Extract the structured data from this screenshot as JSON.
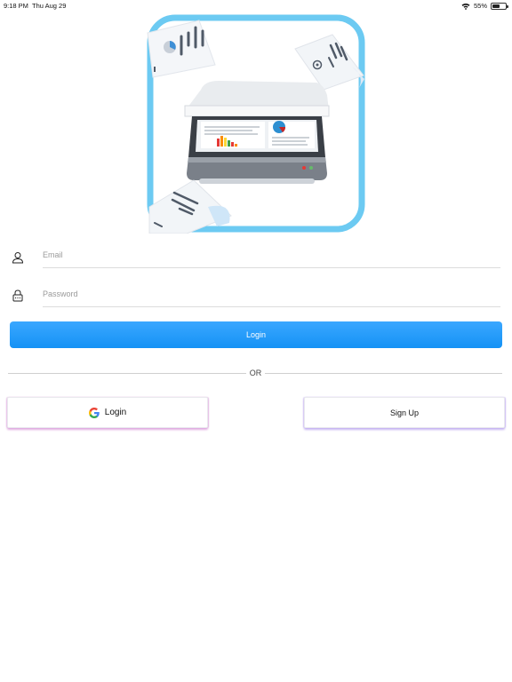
{
  "status_bar": {
    "time": "9:18 PM",
    "date": "Thu Aug 29",
    "battery_percent_text": "55%",
    "battery_level": 0.55
  },
  "app_logo": {
    "name": "scanner-app-logo",
    "border_color": "#6ccaf2"
  },
  "form": {
    "email_placeholder": "Email",
    "password_placeholder": "Password",
    "login_label": "Login"
  },
  "divider": {
    "text": "OR"
  },
  "social": {
    "google_login_label": "Login",
    "signup_label": "Sign Up"
  },
  "colors": {
    "primary_gradient_top": "#3aa7ff",
    "primary_gradient_bottom": "#1592f5",
    "google_shadow": "#dca0dc",
    "signup_shadow": "#beaaf0"
  }
}
